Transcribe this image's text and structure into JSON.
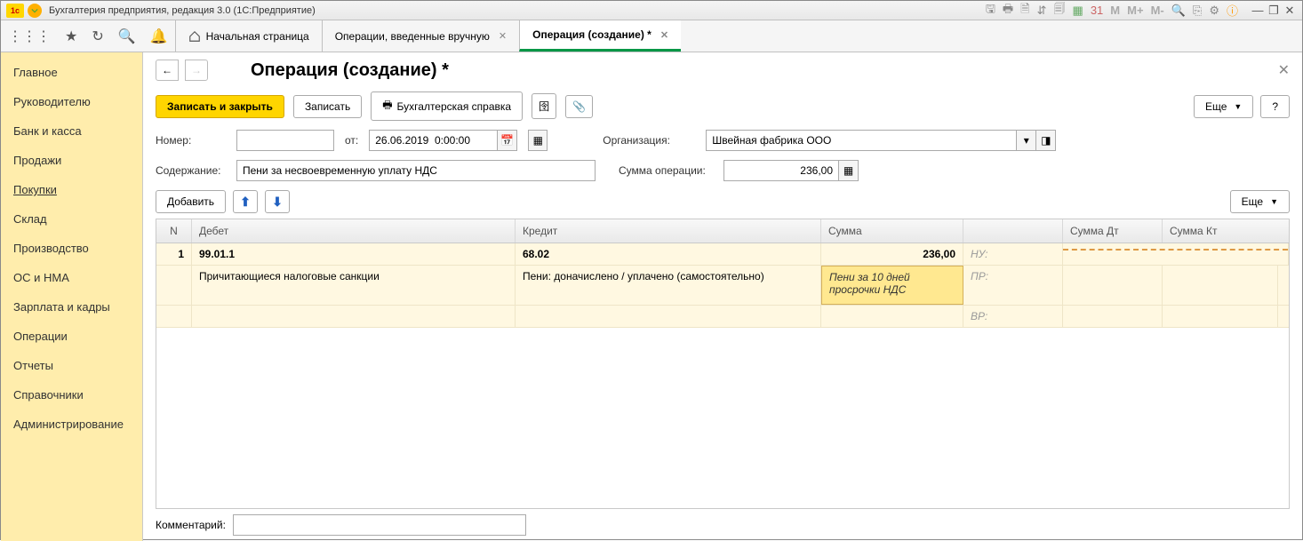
{
  "title_bar": {
    "app_title": "Бухгалтерия предприятия, редакция 3.0  (1С:Предприятие)",
    "tool_icons": [
      "save-icon",
      "print-icon",
      "preview-icon",
      "compare-icon",
      "copy-icon",
      "calendar-icon",
      "date31-icon"
    ],
    "m_labels": [
      "M",
      "M+",
      "M-"
    ],
    "window_icons": [
      "minimize-icon",
      "restore-icon",
      "close-icon"
    ]
  },
  "tabs": {
    "home": "Начальная страница",
    "tab1": "Операции, введенные вручную",
    "tab2": "Операция (создание) *"
  },
  "sidebar": {
    "items": [
      "Главное",
      "Руководителю",
      "Банк и касса",
      "Продажи",
      "Покупки",
      "Склад",
      "Производство",
      "ОС и НМА",
      "Зарплата и кадры",
      "Операции",
      "Отчеты",
      "Справочники",
      "Администрирование"
    ],
    "active_index": 4
  },
  "page": {
    "title": "Операция (создание) *",
    "btn_save_close": "Записать и закрыть",
    "btn_save": "Записать",
    "btn_report": "Бухгалтерская справка",
    "btn_more": "Еще",
    "help": "?",
    "lbl_number": "Номер:",
    "lbl_from": "от:",
    "date_value": "26.06.2019  0:00:00",
    "lbl_org": "Организация:",
    "org_value": "Швейная фабрика ООО",
    "lbl_content": "Содержание:",
    "content_value": "Пени за несвоевременную уплату НДС",
    "lbl_opsum": "Сумма операции:",
    "opsum_value": "236,00",
    "btn_add": "Добавить",
    "table": {
      "headers": {
        "n": "N",
        "debit": "Дебет",
        "credit": "Кредит",
        "sum": "Сумма",
        "sum_dt": "Сумма Дт",
        "sum_kt": "Сумма Кт"
      },
      "sub_labels": {
        "nu": "НУ:",
        "pr": "ПР:",
        "vr": "ВР:"
      },
      "row": {
        "n": "1",
        "debit_acct": "99.01.1",
        "credit_acct": "68.02",
        "sum": "236,00",
        "debit_sub": "Причитающиеся налоговые санкции",
        "credit_sub": "Пени: доначислено / уплачено (самостоятельно)",
        "edit_text": "Пени за 10 дней просрочки НДС"
      }
    },
    "lbl_comment": "Комментарий:"
  }
}
